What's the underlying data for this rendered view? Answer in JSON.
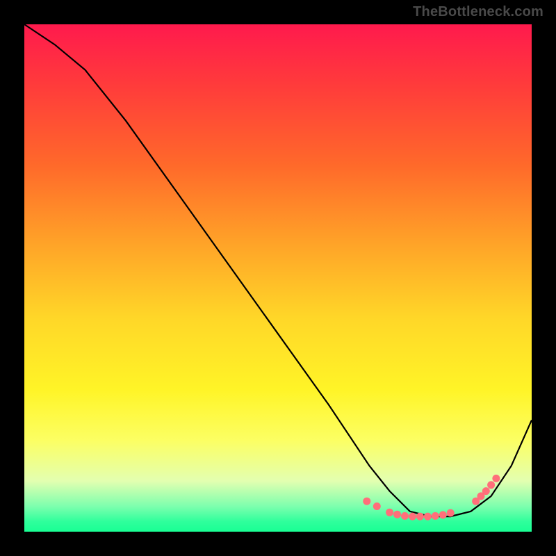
{
  "watermark": {
    "text": "TheBottleneck.com"
  },
  "chart_data": {
    "type": "line",
    "title": "",
    "xlabel": "",
    "ylabel": "",
    "xlim": [
      0,
      100
    ],
    "ylim": [
      0,
      100
    ],
    "grid": false,
    "legend": false,
    "series": [
      {
        "name": "curve",
        "color": "#000000",
        "x": [
          0,
          6,
          12,
          20,
          30,
          40,
          50,
          60,
          68,
          72,
          76,
          80,
          84,
          88,
          92,
          96,
          100
        ],
        "y": [
          100,
          96,
          91,
          81,
          67,
          53,
          39,
          25,
          13,
          8,
          4,
          3,
          3,
          4,
          7,
          13,
          22
        ]
      }
    ],
    "markers": [
      {
        "name": "dots-left-cluster",
        "color": "#ff6f7a",
        "x": [
          67.5,
          69.5,
          72.0,
          73.5,
          75.0,
          76.5,
          78.0,
          79.5,
          81.0,
          82.5,
          84.0
        ],
        "y": [
          6.0,
          5.0,
          3.8,
          3.4,
          3.1,
          3.0,
          3.0,
          3.0,
          3.1,
          3.3,
          3.7
        ]
      },
      {
        "name": "dots-right-cluster",
        "color": "#ff6f7a",
        "x": [
          89.0,
          90.0,
          91.0,
          92.0,
          93.0
        ],
        "y": [
          6.0,
          7.0,
          8.0,
          9.2,
          10.5
        ]
      }
    ],
    "background_gradient": {
      "stops": [
        {
          "pos": 0,
          "color": "#ff1a4d"
        },
        {
          "pos": 12,
          "color": "#ff3b3b"
        },
        {
          "pos": 28,
          "color": "#ff6a2a"
        },
        {
          "pos": 44,
          "color": "#ffa628"
        },
        {
          "pos": 58,
          "color": "#ffd728"
        },
        {
          "pos": 72,
          "color": "#fff427"
        },
        {
          "pos": 82,
          "color": "#fcff63"
        },
        {
          "pos": 90,
          "color": "#e3ffb0"
        },
        {
          "pos": 95,
          "color": "#7dffae"
        },
        {
          "pos": 98,
          "color": "#2fff9c"
        },
        {
          "pos": 100,
          "color": "#19ff94"
        }
      ]
    }
  }
}
